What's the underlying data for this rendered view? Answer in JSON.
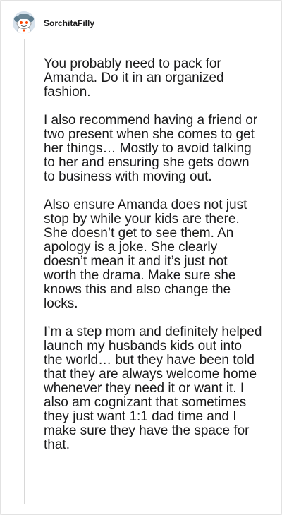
{
  "comment": {
    "username": "SorchitaFilly",
    "avatar_icon": "reddit-snoo-avatar-icon",
    "paragraphs": [
      "You probably need to pack for Amanda. Do it in an organized fashion.",
      "I also recommend having a friend or two present when she comes to get her things… Mostly to avoid talking to her and ensuring she gets down to business with moving out.",
      "Also ensure Amanda does not just stop by while your kids are there. She doesn’t get to see them. An apology is a joke. She clearly doesn’t mean it and it’s just not worth the drama. Make sure she knows this and also change the locks.",
      "I’m a step mom and definitely helped launch my husbands kids out into the world… but they have been told that they are always welcome home whenever they need it or want it. I also am cognizant that sometimes they just want 1:1 dad time and I make sure they have the space for that."
    ]
  }
}
